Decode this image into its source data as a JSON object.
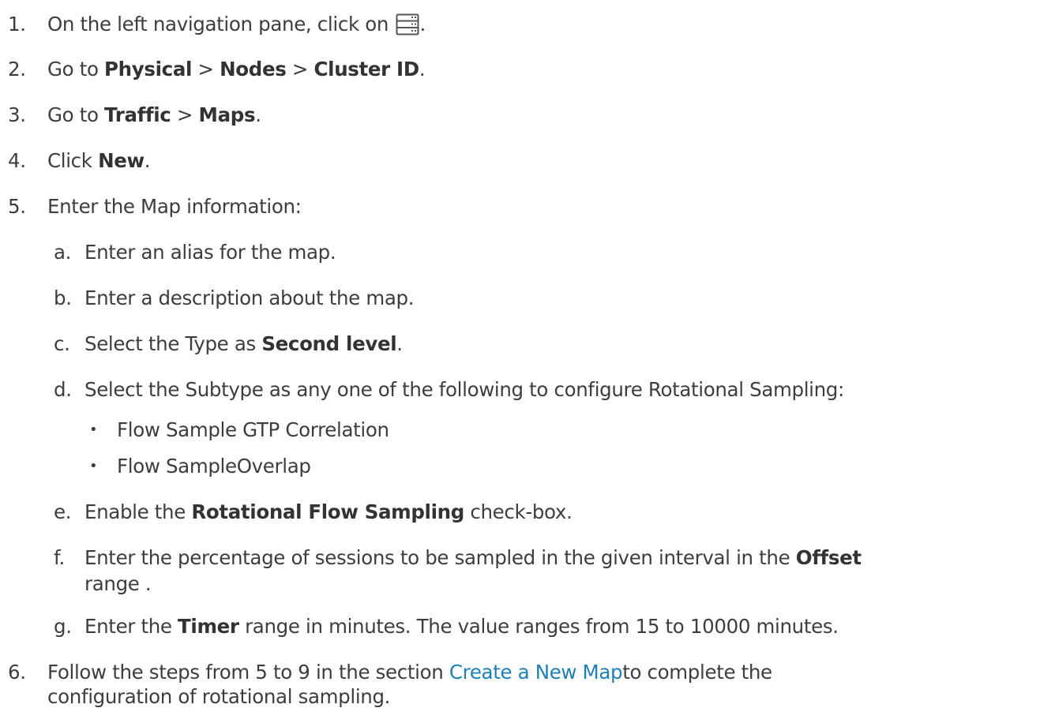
{
  "steps": {
    "s1": {
      "num": "1.",
      "text": "On the left navigation pane, click on ",
      "after_icon": ".",
      "icon": "server-rack-icon"
    },
    "s2": {
      "num": "2.",
      "t1": "Go to ",
      "b1": "Physical",
      "sep1": " > ",
      "b2": "Nodes",
      "sep2": " > ",
      "b3": "Cluster ID",
      "end": "."
    },
    "s3": {
      "num": "3.",
      "t1": "Go to ",
      "b1": "Traffic",
      "sep1": " > ",
      "b2": "Maps",
      "end": "."
    },
    "s4": {
      "num": "4.",
      "t1": "Click ",
      "b1": "New",
      "end": "."
    },
    "s5": {
      "num": "5.",
      "text": "Enter the Map information:",
      "a": {
        "letter": "a.",
        "text": "Enter an alias for the map."
      },
      "b": {
        "letter": "b.",
        "text": "Enter a description about the map."
      },
      "c": {
        "letter": "c.",
        "t1": "Select the Type as ",
        "b1": "Second level",
        "end": "."
      },
      "d": {
        "letter": "d.",
        "text": "Select the Subtype as any one of the following to configure Rotational Sampling:",
        "bullets": [
          "Flow Sample GTP Correlation",
          "Flow SampleOverlap"
        ],
        "bullet_char": "•"
      },
      "e": {
        "letter": "e.",
        "t1": "Enable the ",
        "b1": "Rotational Flow Sampling",
        "t2": " check-box."
      },
      "f": {
        "letter": "f.",
        "t1": "Enter the percentage of sessions to be sampled in the given interval in the ",
        "b1": "Offset",
        "line2": "range ."
      },
      "g": {
        "letter": "g.",
        "t1": "Enter the ",
        "b1": "Timer",
        "t2": " range in minutes. The value ranges from 15 to 10000 minutes."
      }
    },
    "s6": {
      "num": "6.",
      "t1": "Follow the steps from 5 to 9 in the section ",
      "link": "Create a New Map",
      "t2": "to complete the",
      "line2": "configuration of rotational sampling."
    }
  },
  "colors": {
    "text": "#3d3d3d",
    "bold": "#333333",
    "link": "#1d7fb8"
  }
}
